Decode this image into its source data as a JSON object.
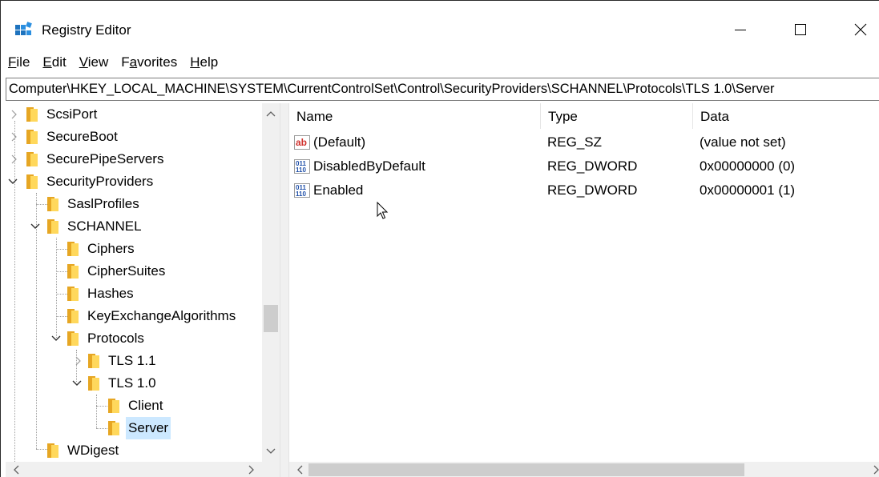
{
  "window": {
    "title": "Registry Editor"
  },
  "menu": {
    "items": [
      {
        "mnemonic": "F",
        "rest": "ile"
      },
      {
        "mnemonic": "E",
        "rest": "dit"
      },
      {
        "mnemonic": "V",
        "rest": "iew"
      },
      {
        "prefix": "F",
        "mnemonic": "a",
        "rest": "vorites"
      },
      {
        "mnemonic": "H",
        "rest": "elp"
      }
    ]
  },
  "address": {
    "path": "Computer\\HKEY_LOCAL_MACHINE\\SYSTEM\\CurrentControlSet\\Control\\SecurityProviders\\SCHANNEL\\Protocols\\TLS 1.0\\Server"
  },
  "tree": {
    "nodes": [
      {
        "label": "ScsiPort",
        "state": "collapsed",
        "selected": false
      },
      {
        "label": "SecureBoot",
        "state": "collapsed",
        "selected": false
      },
      {
        "label": "SecurePipeServers",
        "state": "collapsed",
        "selected": false
      },
      {
        "label": "SecurityProviders",
        "state": "expanded",
        "selected": false
      },
      {
        "label": "SaslProfiles",
        "state": "leaf",
        "selected": false
      },
      {
        "label": "SCHANNEL",
        "state": "expanded",
        "selected": false
      },
      {
        "label": "Ciphers",
        "state": "leaf",
        "selected": false
      },
      {
        "label": "CipherSuites",
        "state": "leaf",
        "selected": false
      },
      {
        "label": "Hashes",
        "state": "leaf",
        "selected": false
      },
      {
        "label": "KeyExchangeAlgorithms",
        "state": "leaf",
        "selected": false
      },
      {
        "label": "Protocols",
        "state": "expanded",
        "selected": false
      },
      {
        "label": "TLS 1.1",
        "state": "collapsed",
        "selected": false
      },
      {
        "label": "TLS 1.0",
        "state": "expanded",
        "selected": false
      },
      {
        "label": "Client",
        "state": "leaf",
        "selected": false
      },
      {
        "label": "Server",
        "state": "leaf",
        "selected": true
      },
      {
        "label": "WDigest",
        "state": "leaf",
        "selected": false
      }
    ]
  },
  "list": {
    "columns": {
      "name": "Name",
      "type": "Type",
      "data": "Data"
    },
    "rows": [
      {
        "name": "(Default)",
        "type": "REG_SZ",
        "data": "(value not set)",
        "icon": "string-value-icon"
      },
      {
        "name": "DisabledByDefault",
        "type": "REG_DWORD",
        "data": "0x00000000 (0)",
        "icon": "binary-value-icon"
      },
      {
        "name": "Enabled",
        "type": "REG_DWORD",
        "data": "0x00000001 (1)",
        "icon": "binary-value-icon"
      }
    ]
  },
  "colors": {
    "selection": "#cce8ff",
    "folder_dark": "#e6a623",
    "folder_light": "#ffd85c",
    "scrollbar": "#f0f0f0",
    "thumb": "#cdcdcd"
  }
}
